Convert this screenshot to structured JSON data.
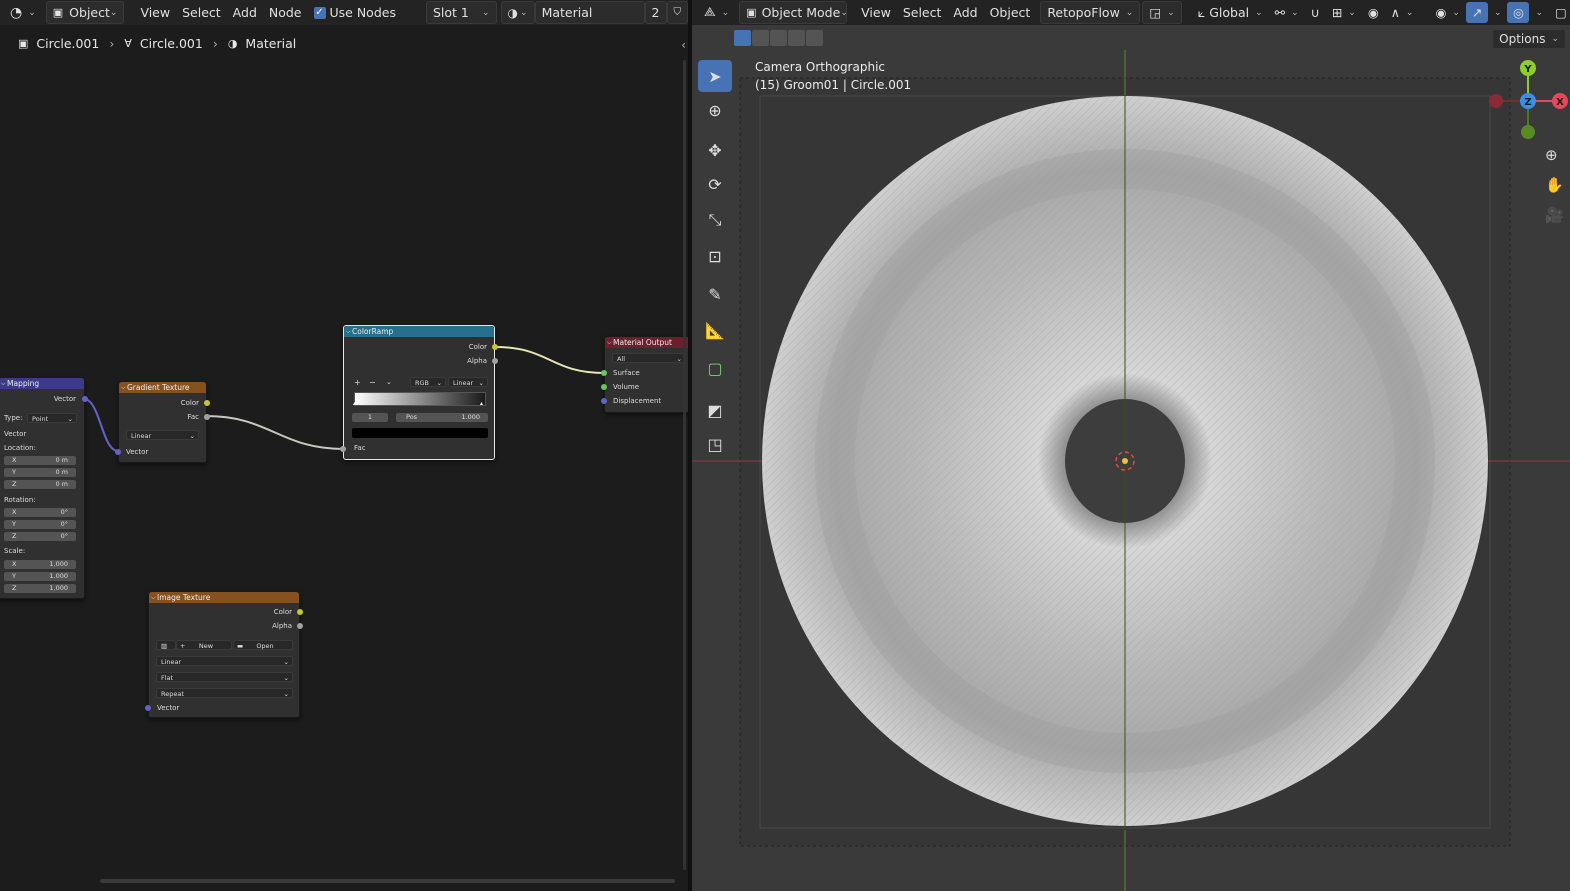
{
  "node_editor": {
    "header": {
      "editor_type_icon": "node-editor-icon",
      "object_label": "Object",
      "menus": [
        "View",
        "Select",
        "Add",
        "Node"
      ],
      "use_nodes_label": "Use Nodes",
      "use_nodes_checked": true,
      "slot_label": "Slot 1",
      "material_name": "Material",
      "user_count": "2"
    },
    "breadcrumb": {
      "object": "Circle.001",
      "mesh": "Circle.001",
      "material": "Material"
    },
    "nodes": {
      "mapping": {
        "title": "Mapping",
        "output_vector": "Vector",
        "type_label": "Type:",
        "type_value": "Point",
        "vector_label": "Vector",
        "location_label": "Location:",
        "location": [
          {
            "axis": "X",
            "value": "0 m"
          },
          {
            "axis": "Y",
            "value": "0 m"
          },
          {
            "axis": "Z",
            "value": "0 m"
          }
        ],
        "rotation_label": "Rotation:",
        "rotation": [
          {
            "axis": "X",
            "value": "0°"
          },
          {
            "axis": "Y",
            "value": "0°"
          },
          {
            "axis": "Z",
            "value": "0°"
          }
        ],
        "scale_label": "Scale:",
        "scale": [
          {
            "axis": "X",
            "value": "1.000"
          },
          {
            "axis": "Y",
            "value": "1.000"
          },
          {
            "axis": "Z",
            "value": "1.000"
          }
        ]
      },
      "gradient_texture": {
        "title": "Gradient Texture",
        "output_color": "Color",
        "output_fac": "Fac",
        "gradient_type": "Linear",
        "input_vector": "Vector"
      },
      "color_ramp": {
        "title": "ColorRamp",
        "output_color": "Color",
        "output_alpha": "Alpha",
        "add_label": "+",
        "remove_label": "−",
        "color_mode": "RGB",
        "interpolation": "Linear",
        "stop_index": "1",
        "pos_label": "Pos",
        "pos_value": "1.000",
        "input_fac": "Fac"
      },
      "material_output": {
        "title": "Material Output",
        "target": "All",
        "input_surface": "Surface",
        "input_volume": "Volume",
        "input_displacement": "Displacement"
      },
      "image_texture": {
        "title": "Image Texture",
        "output_color": "Color",
        "output_alpha": "Alpha",
        "new_label": "New",
        "open_label": "Open",
        "interpolation": "Linear",
        "projection": "Flat",
        "extension": "Repeat",
        "input_vector": "Vector"
      }
    },
    "colors": {
      "mapping_header": "#3b3b89",
      "texture_header": "#87501f",
      "converter_header": "#266f8e",
      "output_header": "#6c1f2c",
      "socket_vector": "#6363c7",
      "socket_color": "#c7c729",
      "socket_float": "#a1a1a1",
      "socket_shader": "#63c763"
    }
  },
  "viewport": {
    "header": {
      "mode_label": "Object Mode",
      "menus": [
        "View",
        "Select",
        "Add",
        "Object"
      ],
      "addon_label": "RetopoFlow",
      "orientation_label": "Global"
    },
    "options_label": "Options",
    "camera_label": "Camera Orthographic",
    "object_info": "(15) Groom01 | Circle.001",
    "gizmo_axes": {
      "x": "X",
      "y": "Y",
      "z": "Z"
    },
    "tools": [
      "select-box-icon",
      "cursor-icon",
      "move-icon",
      "rotate-icon",
      "scale-icon",
      "transform-icon",
      "annotate-icon",
      "measure-icon",
      "add-cube-icon",
      "shrink-fatten-icon",
      "shear-icon"
    ]
  }
}
